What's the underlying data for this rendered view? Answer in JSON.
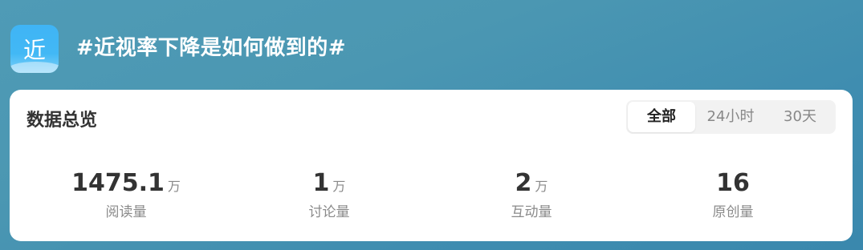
{
  "header": {
    "icon_char": "近",
    "topic_title": "#近视率下降是如何做到的#"
  },
  "overview": {
    "title": "数据总览",
    "tabs": [
      "全部",
      "24小时",
      "30天"
    ],
    "selected_tab": "全部",
    "stats": [
      {
        "value": "1475.1",
        "unit": "万",
        "label": "阅读量"
      },
      {
        "value": "1",
        "unit": "万",
        "label": "讨论量"
      },
      {
        "value": "2",
        "unit": "万",
        "label": "互动量"
      },
      {
        "value": "16",
        "unit": "",
        "label": "原创量"
      }
    ]
  }
}
